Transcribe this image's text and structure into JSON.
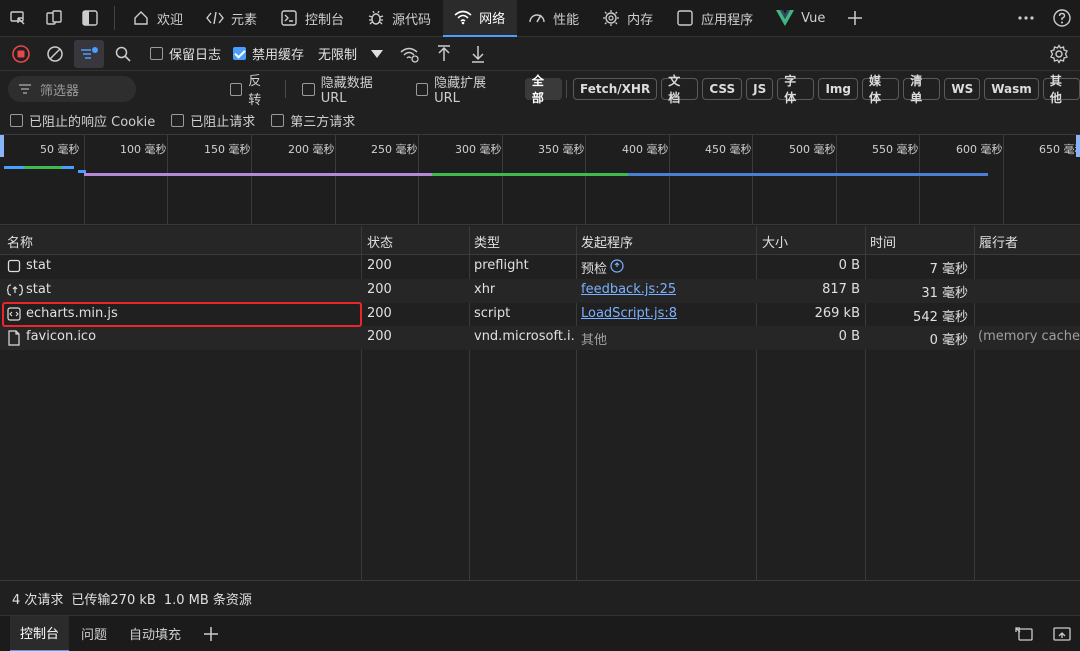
{
  "tabs": [
    {
      "label": "欢迎",
      "icon": "home-icon"
    },
    {
      "label": "元素",
      "icon": "code-icon"
    },
    {
      "label": "控制台",
      "icon": "console-icon"
    },
    {
      "label": "源代码",
      "icon": "bug-icon"
    },
    {
      "label": "网络",
      "icon": "wifi-icon",
      "active": true
    },
    {
      "label": "性能",
      "icon": "gauge-icon"
    },
    {
      "label": "内存",
      "icon": "memory-icon"
    },
    {
      "label": "应用程序",
      "icon": "app-icon"
    },
    {
      "label": "Vue",
      "icon": "vue-icon"
    }
  ],
  "toolbar": {
    "preserve_log": "保留日志",
    "disable_cache": "禁用缓存",
    "throttle": "无限制"
  },
  "filter": {
    "placeholder": "筛选器",
    "invert": "反转",
    "hide_data_url": "隐藏数据 URL",
    "hide_ext_url": "隐藏扩展 URL",
    "types": [
      "全部",
      "Fetch/XHR",
      "文档",
      "CSS",
      "JS",
      "字体",
      "Img",
      "媒体",
      "清单",
      "WS",
      "Wasm",
      "其他"
    ],
    "blocked_cookies": "已阻止的响应 Cookie",
    "blocked_requests": "已阻止请求",
    "third_party": "第三方请求"
  },
  "timeline": {
    "ticks": [
      "50 毫秒",
      "100 毫秒",
      "150 毫秒",
      "200 毫秒",
      "250 毫秒",
      "300 毫秒",
      "350 毫秒",
      "400 毫秒",
      "450 毫秒",
      "500 毫秒",
      "550 毫秒",
      "600 毫秒",
      "650 毫秒"
    ]
  },
  "table": {
    "headers": [
      "名称",
      "状态",
      "类型",
      "发起程序",
      "大小",
      "时间",
      "履行者"
    ],
    "rows": [
      {
        "name": "stat",
        "status": "200",
        "type": "preflight",
        "initiator": "预检",
        "size": "0 B",
        "time": "7 毫秒",
        "fulfilled": ""
      },
      {
        "name": "stat",
        "status": "200",
        "type": "xhr",
        "initiator": "feedback.js:25",
        "size": "817 B",
        "time": "31 毫秒",
        "fulfilled": ""
      },
      {
        "name": "echarts.min.js",
        "status": "200",
        "type": "script",
        "initiator": "LoadScript.js:8",
        "size": "269 kB",
        "time": "542 毫秒",
        "fulfilled": ""
      },
      {
        "name": "favicon.ico",
        "status": "200",
        "type": "vnd.microsoft.i...",
        "initiator": "其他",
        "size": "0 B",
        "time": "0 毫秒",
        "fulfilled": "(memory cache)"
      }
    ]
  },
  "status": {
    "requests": "4 次请求",
    "transferred": "已传输270 kB",
    "resources": "1.0 MB 条资源"
  },
  "drawer": {
    "tabs": [
      "控制台",
      "问题",
      "自动填充"
    ]
  },
  "colors": {
    "accent": "#4a9eff",
    "highlight": "#e8262b",
    "link": "#7cb0ff"
  }
}
